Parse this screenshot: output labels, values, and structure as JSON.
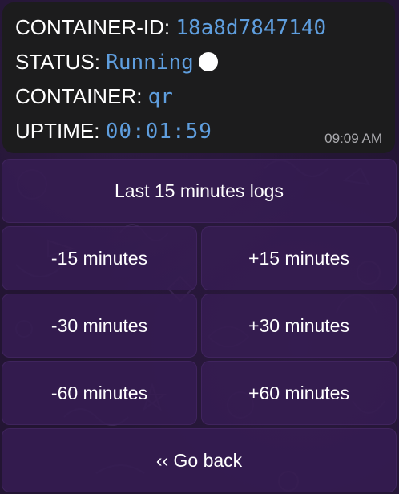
{
  "message": {
    "container_id_label": "CONTAINER-ID:",
    "container_id_value": "18a8d7847140",
    "status_label": "STATUS:",
    "status_value": "Running",
    "status_indicator": "white-circle-icon",
    "container_label": "CONTAINER:",
    "container_value": "qr",
    "uptime_label": "UPTIME:",
    "uptime_value": "00:01:59",
    "time": "09:09 AM"
  },
  "keyboard": {
    "logs": "Last 15 minutes logs",
    "minus15": "-15 minutes",
    "plus15": "+15 minutes",
    "minus30": "-30 minutes",
    "plus30": "+30 minutes",
    "minus60": "-60 minutes",
    "plus60": "+60 minutes",
    "back": "‹‹ Go back"
  },
  "colors": {
    "background": "#231533",
    "bubble": "#1c1c1d",
    "value_text": "#5f9ede",
    "button": "#361c52"
  }
}
